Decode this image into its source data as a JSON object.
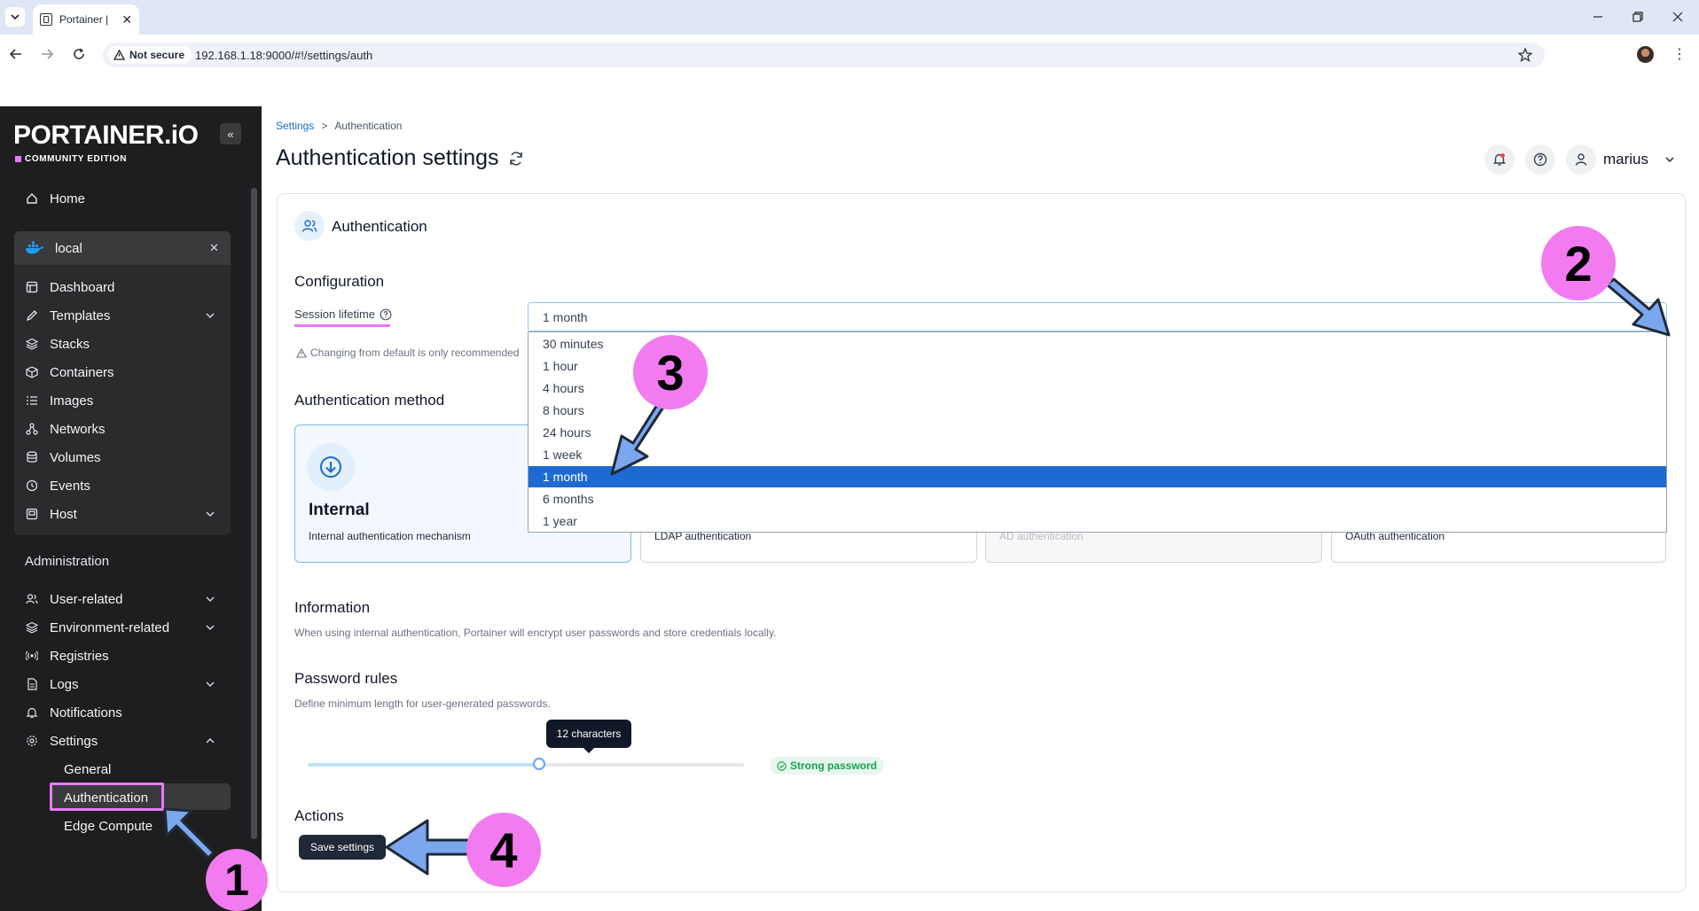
{
  "browser": {
    "tab_title": "Portainer |",
    "not_secure": "Not secure",
    "url": "192.168.1.18:9000/#!/settings/auth"
  },
  "sidebar": {
    "logo": "PORTAINER.iO",
    "edition": "COMMUNITY EDITION",
    "home": "Home",
    "environment": "local",
    "env_items": [
      "Dashboard",
      "Templates",
      "Stacks",
      "Containers",
      "Images",
      "Networks",
      "Volumes",
      "Events",
      "Host"
    ],
    "admin_label": "Administration",
    "admin_items": [
      "User-related",
      "Environment-related",
      "Registries",
      "Logs",
      "Notifications",
      "Settings"
    ],
    "settings_sub": [
      "General",
      "Authentication",
      "Edge Compute"
    ]
  },
  "header": {
    "breadcrumb_root": "Settings",
    "breadcrumb_sep": ">",
    "breadcrumb_current": "Authentication",
    "title": "Authentication settings",
    "user": "marius"
  },
  "card": {
    "title": "Authentication",
    "config_title": "Configuration",
    "session_label": "Session lifetime",
    "session_value": "1 month",
    "session_warning": "Changing from default is only recommended",
    "session_options": [
      "30 minutes",
      "1 hour",
      "4 hours",
      "8 hours",
      "24 hours",
      "1 week",
      "1 month",
      "6 months",
      "1 year"
    ],
    "selected_option": "1 month",
    "method_title": "Authentication method",
    "methods": [
      {
        "name": "Internal",
        "desc": "Internal authentication mechanism"
      },
      {
        "desc": "LDAP authentication"
      },
      {
        "desc": "AD authentication"
      },
      {
        "desc": "OAuth authentication"
      }
    ],
    "info_title": "Information",
    "info_text": "When using internal authentication, Portainer will encrypt user passwords and store credentials locally.",
    "password_title": "Password rules",
    "password_text": "Define minimum length for user-generated passwords.",
    "password_tooltip": "12 characters",
    "password_strength": "Strong password",
    "password_slider_fraction": 0.53,
    "actions_title": "Actions",
    "save_label": "Save settings"
  },
  "annotations": {
    "badges": [
      "1",
      "2",
      "3",
      "4"
    ],
    "badge_color": "#f27bf0",
    "arrow_color": "#7aa7ee"
  },
  "colors": {
    "accent": "#1d6ad3",
    "sidebar_bg": "#1e1e20",
    "highlight": "#e879f9"
  }
}
